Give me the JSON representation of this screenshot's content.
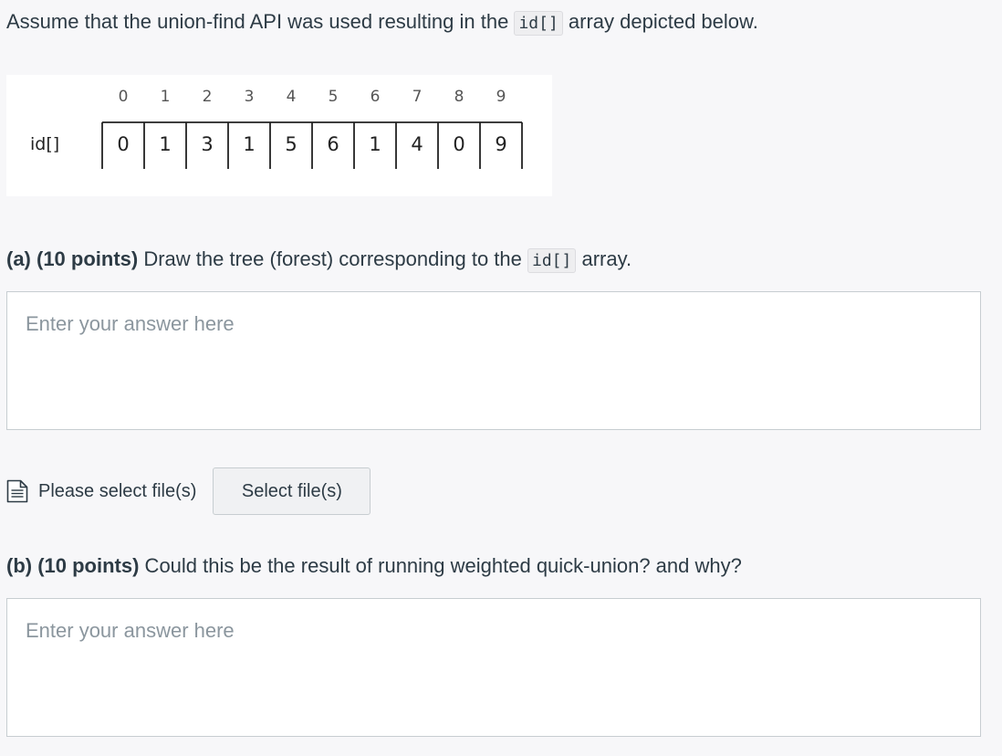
{
  "prompt": {
    "before": "Assume that the union-find API was used resulting in the ",
    "code": "id[]",
    "after": " array depicted below."
  },
  "figure": {
    "row_label": "id[]",
    "indices": [
      "0",
      "1",
      "2",
      "3",
      "4",
      "5",
      "6",
      "7",
      "8",
      "9"
    ],
    "values": [
      "0",
      "1",
      "3",
      "1",
      "5",
      "6",
      "1",
      "4",
      "0",
      "9"
    ]
  },
  "question_a": {
    "label": "(a) (10 points)",
    "text_before": " Draw the tree (forest) corresponding to the ",
    "code": "id[]",
    "text_after": " array.",
    "placeholder": "Enter your answer here"
  },
  "upload": {
    "icon": "document-icon",
    "label": "Please select file(s)",
    "button": "Select file(s)"
  },
  "question_b": {
    "label": "(b) (10 points)",
    "text": " Could this be the result of running weighted quick-union? and why?",
    "placeholder": "Enter your answer here"
  }
}
